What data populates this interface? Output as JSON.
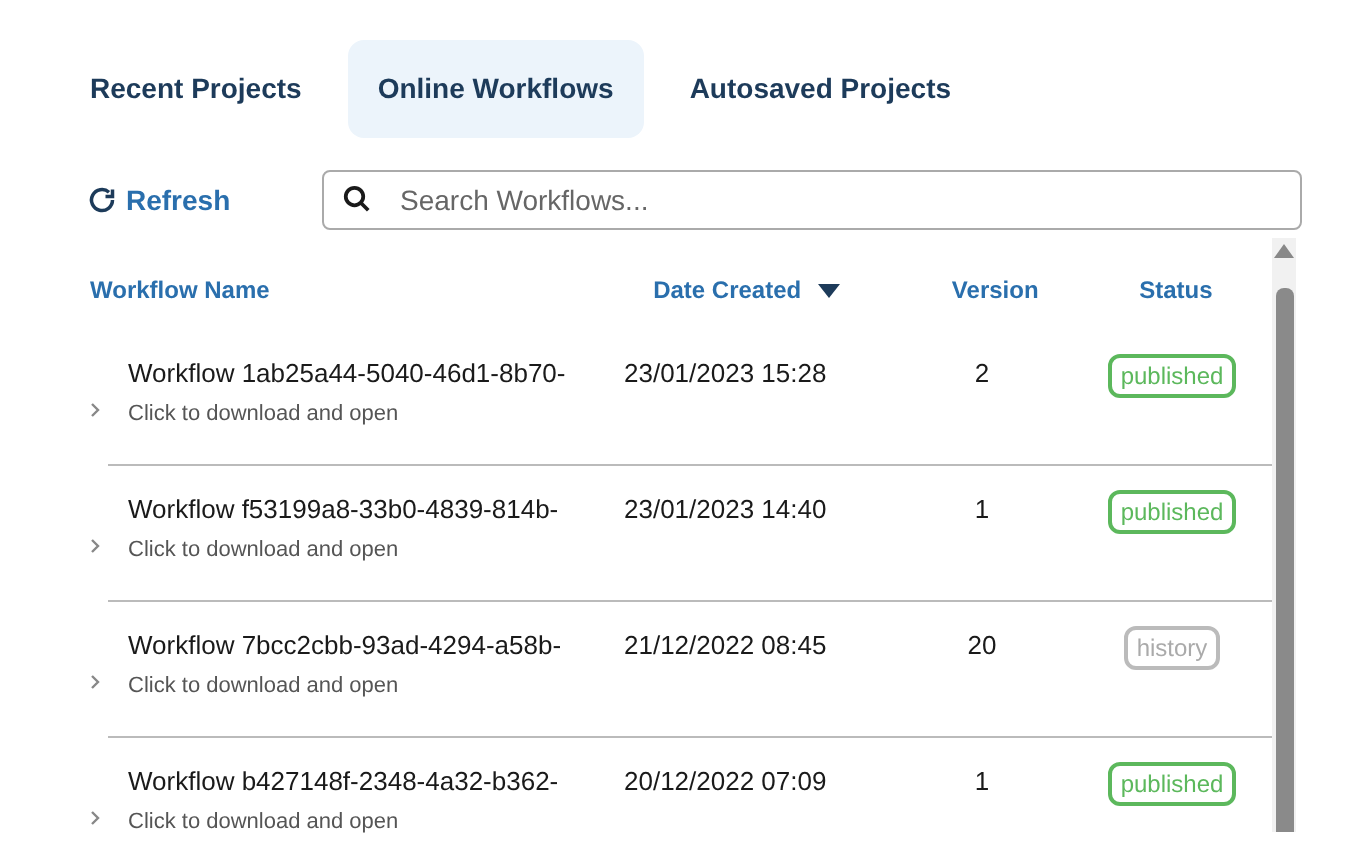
{
  "tabs": [
    {
      "label": "Recent Projects",
      "selected": false
    },
    {
      "label": "Online Workflows",
      "selected": true
    },
    {
      "label": "Autosaved Projects",
      "selected": false
    }
  ],
  "toolbar": {
    "refresh": "Refresh",
    "search": {
      "placeholder": "Search Workflows..."
    }
  },
  "table": {
    "columns": [
      {
        "label": "Workflow Name",
        "sorted": false
      },
      {
        "label": "Date Created",
        "sorted": true
      },
      {
        "label": "Version",
        "sorted": false
      },
      {
        "label": "Status",
        "sorted": false
      }
    ],
    "rows": [
      {
        "name": "Workflow 1ab25a44-5040-46d1-8b70-",
        "subtitle": "Click to download and open",
        "date": "23/01/2023 15:28",
        "version": "2",
        "status": {
          "kind": "published",
          "label": "published"
        }
      },
      {
        "name": "Workflow f53199a8-33b0-4839-814b-",
        "subtitle": "Click to download and open",
        "date": "23/01/2023 14:40",
        "version": "1",
        "status": {
          "kind": "published",
          "label": "published"
        }
      },
      {
        "name": "Workflow 7bcc2cbb-93ad-4294-a58b-",
        "subtitle": "Click to download and open",
        "date": "21/12/2022 08:45",
        "version": "20",
        "status": {
          "kind": "history",
          "label": "history"
        }
      },
      {
        "name": "Workflow b427148f-2348-4a32-b362-",
        "subtitle": "Click to download and open",
        "date": "20/12/2022 07:09",
        "version": "1",
        "status": {
          "kind": "published",
          "label": "published"
        }
      }
    ]
  }
}
